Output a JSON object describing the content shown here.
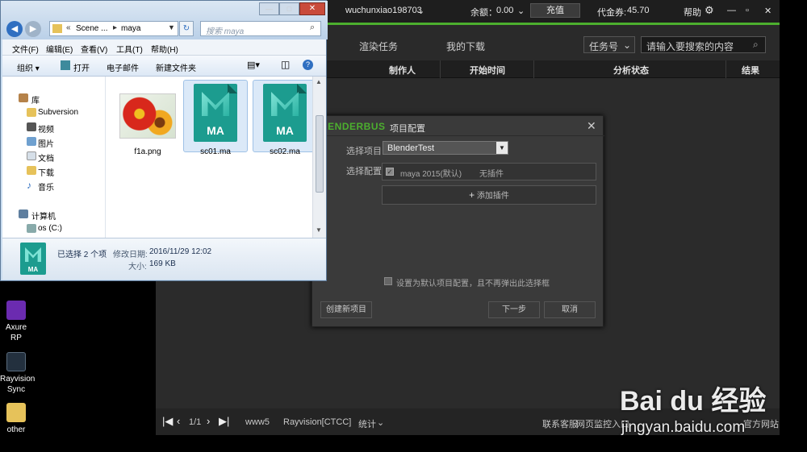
{
  "desktop": {
    "icons": [
      {
        "label": "Axure RP"
      },
      {
        "label": "Rayvision Sync"
      },
      {
        "label": "other"
      }
    ]
  },
  "renderbus": {
    "user": "wuchunxiao198703",
    "balance_label": "余额：",
    "balance_value": "0.00",
    "recharge_button": "充值",
    "voucher_label": "代金券:",
    "voucher_value": "45.70",
    "help_label": "帮助",
    "tabs": [
      "渲染任务",
      "我的下载"
    ],
    "filter_select": "任务号",
    "search_placeholder": "请输入要搜索的内容",
    "columns": [
      "制作人",
      "开始时间",
      "分析状态",
      "结果"
    ],
    "footer": {
      "page": "1/1",
      "server": "www5",
      "node": "Rayvision[CTCC]",
      "stats": "统计",
      "support": "联系客服",
      "monitor": "网页监控入口",
      "site": "官方网站"
    }
  },
  "dialog": {
    "logo": "RENDERBUS",
    "title": "项目配置",
    "select_project_label": "选择项目:",
    "select_project_value": "BlenderTest",
    "select_config_label": "选择配置:",
    "config_item": "maya 2015(默认)",
    "config_plugin": "无插件",
    "add_plugin": "添加插件",
    "default_checkbox": "设置为默认项目配置，且不再弹出此选择框",
    "create_button": "创建新项目",
    "next_button": "下一步",
    "cancel_button": "取消"
  },
  "explorer": {
    "path_1": "Scene ...",
    "path_2": "maya",
    "search_placeholder": "搜索 maya",
    "menu": [
      "文件(F)",
      "编辑(E)",
      "查看(V)",
      "工具(T)",
      "帮助(H)"
    ],
    "toolbar": [
      "组织 ▾",
      "打开",
      "电子邮件",
      "新建文件夹"
    ],
    "nav": [
      "库",
      "Subversion",
      "视频",
      "图片",
      "文档",
      "下载",
      "音乐",
      "计算机",
      "os (C:)"
    ],
    "files": [
      {
        "name": "f1a.png"
      },
      {
        "name": "sc01.ma",
        "icon_text": "MA"
      },
      {
        "name": "sc02.ma",
        "icon_text": "MA"
      }
    ],
    "status": {
      "selected": "已选择 2 个项",
      "modified_label": "修改日期:",
      "modified_value": "2016/11/29 12:02",
      "size_label": "大小:",
      "size_value": "169 KB",
      "icon_text": "MA"
    }
  },
  "watermark": {
    "brand": "Bai du 经验",
    "url": "jingyan.baidu.com"
  }
}
